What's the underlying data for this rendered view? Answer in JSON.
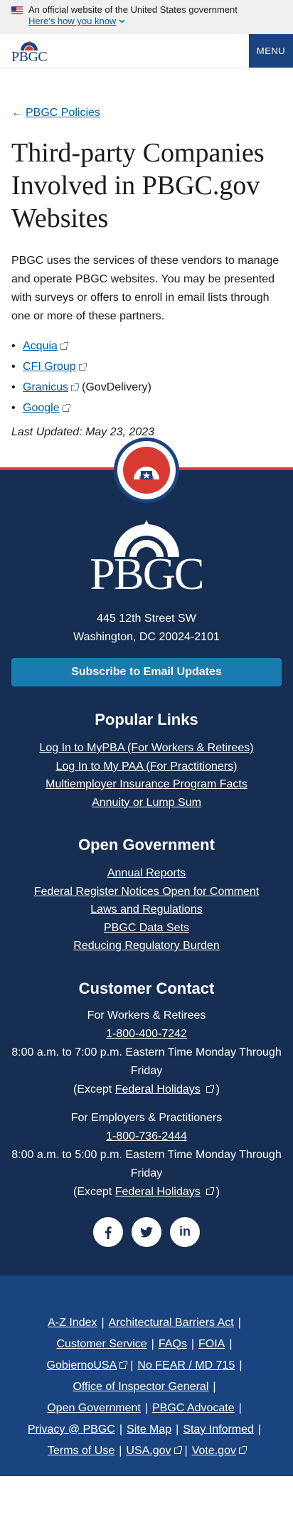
{
  "gov_banner": {
    "text": "An official website of the United States government",
    "link": "Here’s how you know"
  },
  "header": {
    "logo": "PBGC",
    "menu": "MENU"
  },
  "back_link": "PBGC Policies",
  "title": "Third-party Companies Involved in PBGC.gov Websites",
  "intro": "PBGC uses the services of these vendors to manage and operate PBGC websites. You may be presented with surveys or offers to enroll in email lists through one or more of these partners.",
  "vendors": [
    {
      "label": "Acquia",
      "suffix": ""
    },
    {
      "label": "CFI Group",
      "suffix": ""
    },
    {
      "label": "Granicus",
      "suffix": "(GovDelivery)"
    },
    {
      "label": "Google",
      "suffix": ""
    }
  ],
  "last_updated": "Last Updated: May 23, 2023",
  "footer": {
    "logo": "PBGC",
    "address_line1": "445 12th Street SW",
    "address_line2": "Washington, DC 20024-2101",
    "subscribe": "Subscribe to Email Updates",
    "popular_title": "Popular Links",
    "popular_links": [
      "Log In to MyPBA (For Workers & Retirees)",
      "Log In to My PAA (For Practitioners)",
      "Multiemployer Insurance Program Facts",
      "Annuity or Lump Sum"
    ],
    "open_gov_title": "Open Government",
    "open_gov_links": [
      "Annual Reports",
      "Federal Register Notices Open for Comment",
      "Laws and Regulations",
      "PBGC Data Sets",
      "Reducing Regulatory Burden"
    ],
    "contact_title": "Customer Contact",
    "workers": {
      "label": "For Workers & Retirees",
      "phone": "1-800-400-7242",
      "hours": "8:00 a.m. to 7:00 p.m. Eastern Time Monday Through Friday",
      "except_prefix": "(Except",
      "holidays": "Federal Holidays",
      "except_suffix": ")"
    },
    "employers": {
      "label": "For Employers & Practitioners",
      "phone": "1-800-736-2444",
      "hours": "8:00 a.m. to 5:00 p.m. Eastern Time Monday Through Friday",
      "except_prefix": "(Except",
      "holidays": "Federal Holidays",
      "except_suffix": ")"
    },
    "social": {
      "linkedin": "in"
    }
  },
  "bottom_links": {
    "az": "A-Z Index",
    "barriers": "Architectural Barriers Act",
    "customer_service": "Customer Service",
    "faqs": "FAQs",
    "foia": "FOIA",
    "gobierno": "GobiernoUSA",
    "nofear": "No FEAR / MD 715",
    "oig": "Office of Inspector General",
    "open_gov": "Open Government",
    "advocate": "PBGC Advocate",
    "privacy": "Privacy @ PBGC",
    "sitemap": "Site Map",
    "stay": "Stay Informed",
    "terms": "Terms of Use",
    "usagov": "USA.gov",
    "votegov": "Vote.gov",
    "separator": "|"
  },
  "colors": {
    "navy": "#162e51",
    "primary": "#1a4480",
    "link": "#005ea2",
    "red": "#d83933",
    "subscribe": "#1a7bb0"
  }
}
